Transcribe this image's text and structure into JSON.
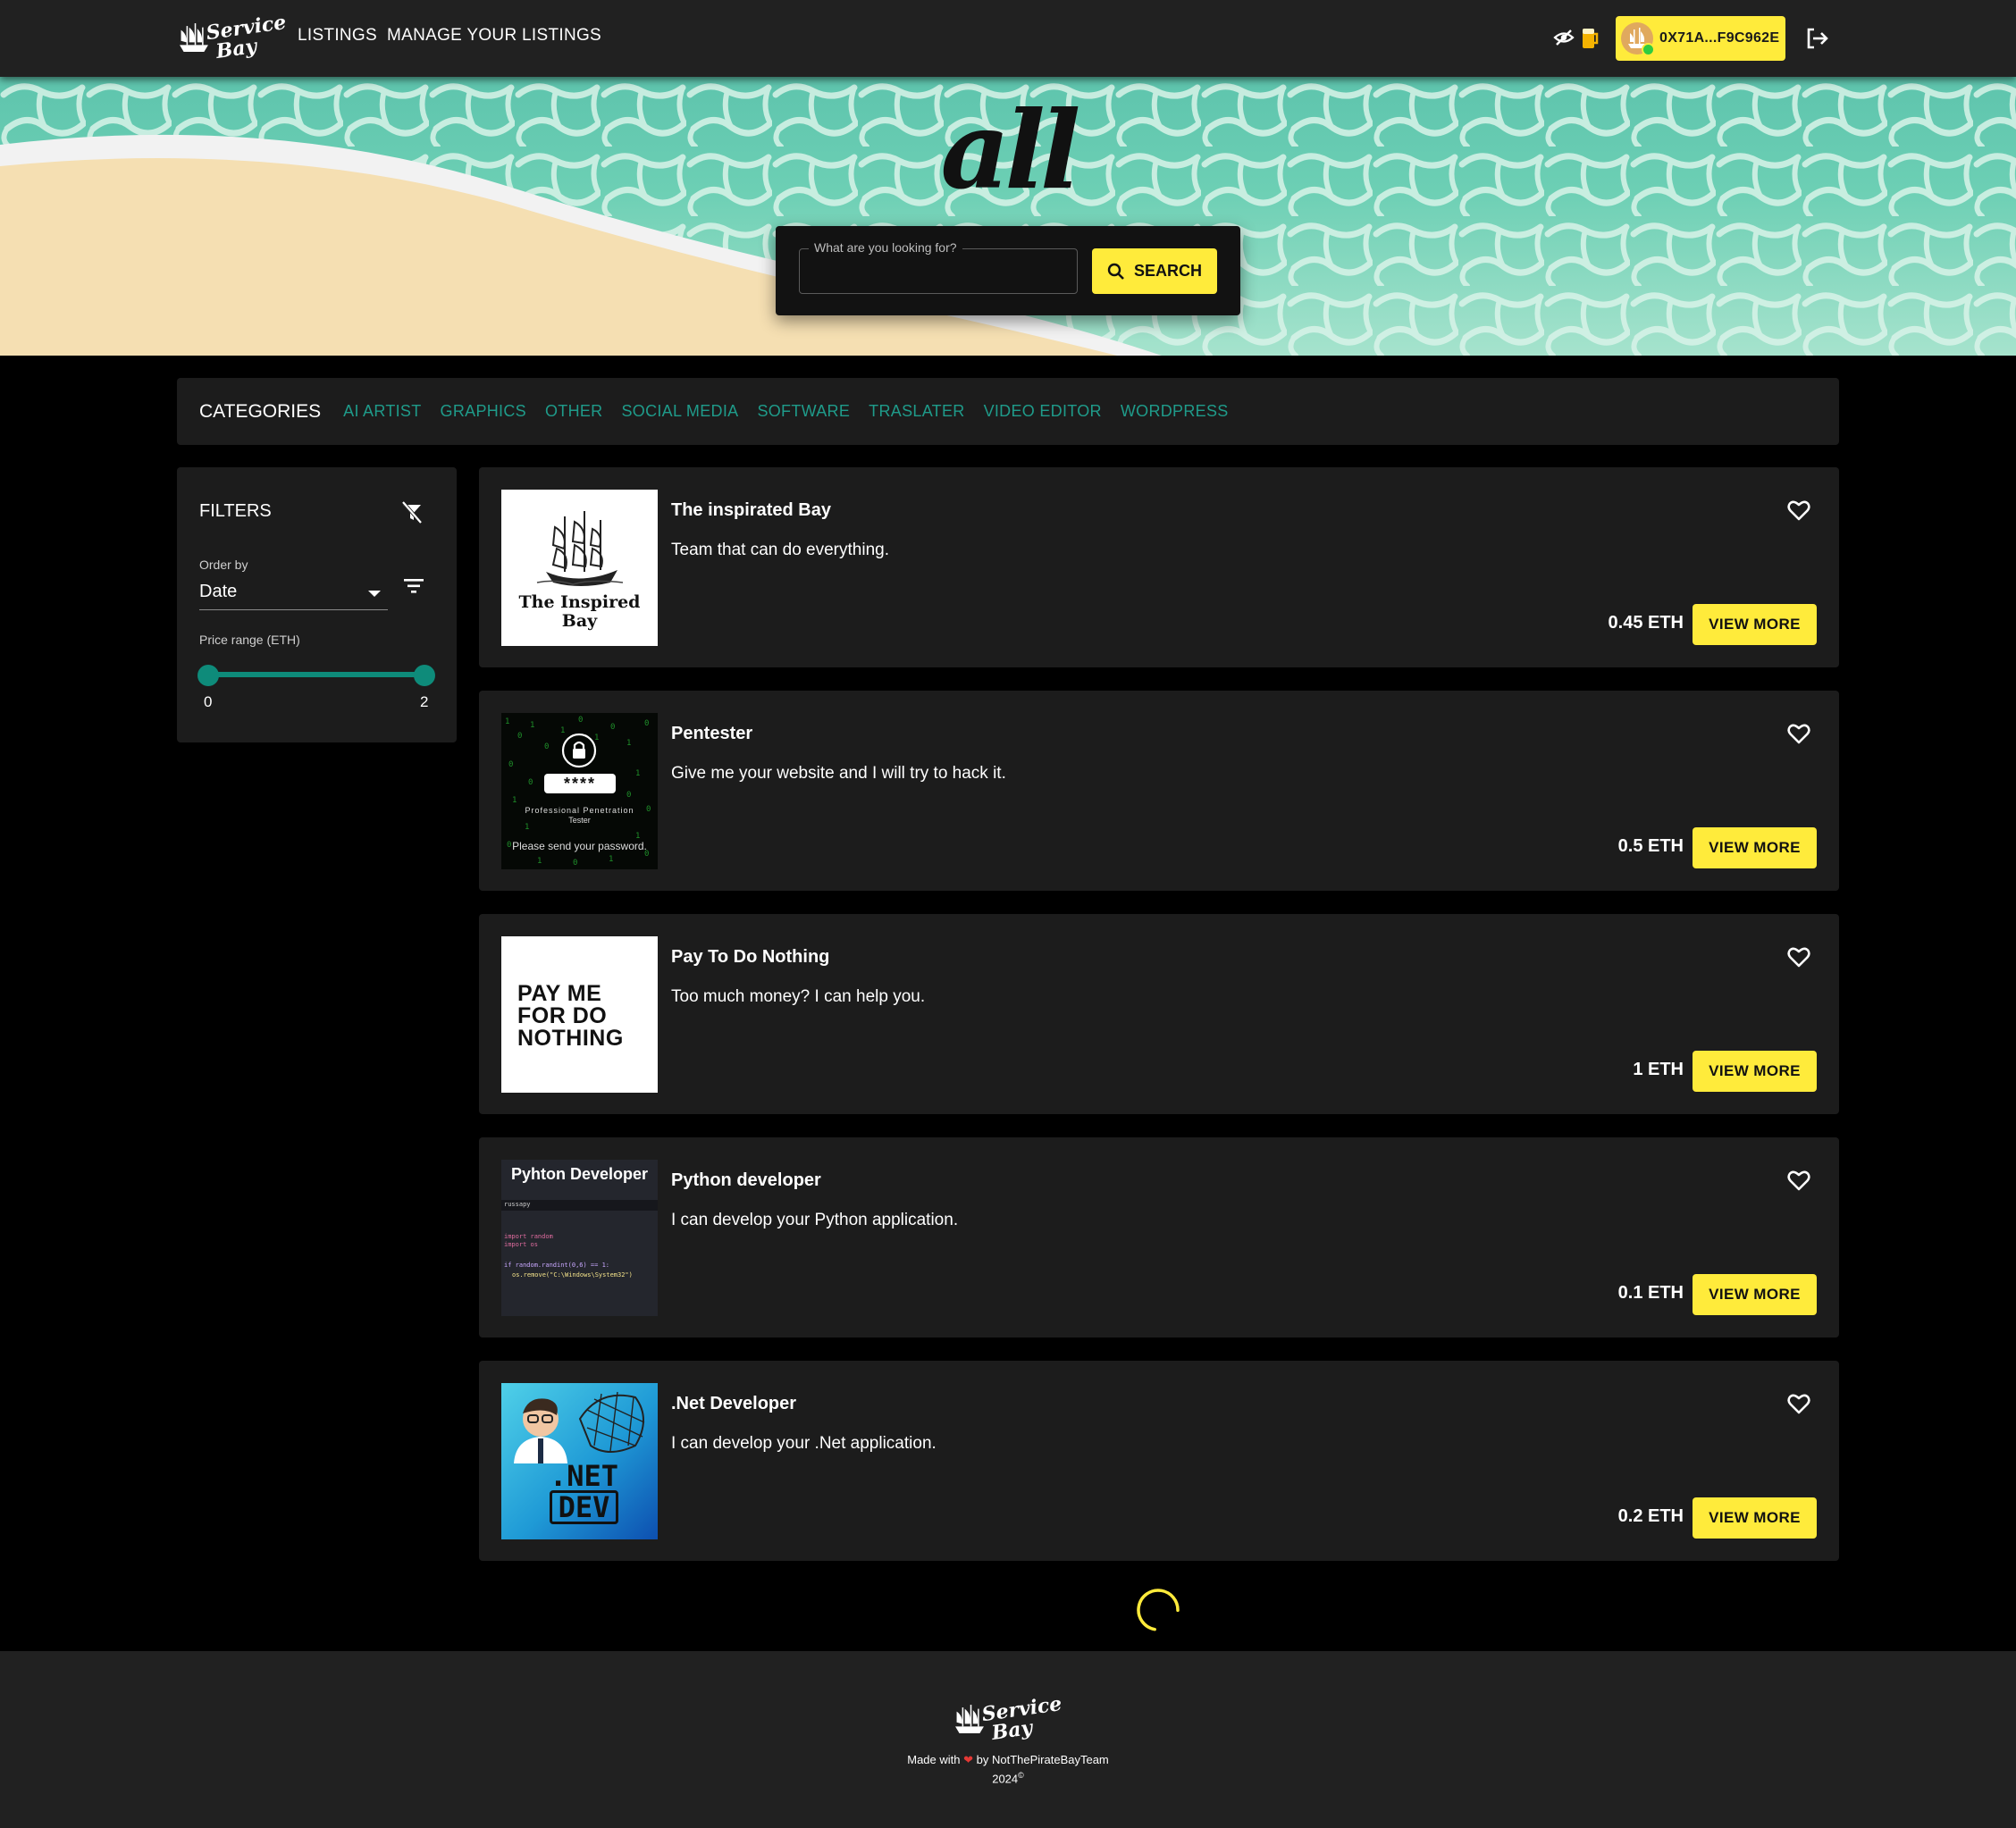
{
  "header": {
    "logo_line1": "Service",
    "logo_line2": "Bay",
    "nav": [
      "LISTINGS",
      "MANAGE YOUR LISTINGS"
    ],
    "wallet_address": "0X71A...F9C962E",
    "icons": [
      "eye-off-icon",
      "beer-icon",
      "logout-icon"
    ]
  },
  "hero": {
    "title": "all",
    "search_legend": "What are you looking for?",
    "search_value": "",
    "search_button": "SEARCH"
  },
  "categories": {
    "title": "CATEGORIES",
    "items": [
      "AI ARTIST",
      "GRAPHICS",
      "OTHER",
      "SOCIAL MEDIA",
      "SOFTWARE",
      "TRASLATER",
      "VIDEO EDITOR",
      "WORDPRESS"
    ]
  },
  "filters": {
    "title": "FILTERS",
    "order_label": "Order by",
    "order_value": "Date",
    "price_label": "Price range (ETH)",
    "price_min": "0",
    "price_max": "2"
  },
  "listings": [
    {
      "title": "The inspirated Bay",
      "description": "Team that can do everything.",
      "price": "0.45 ETH",
      "image_text": [
        "The Inspired",
        "Bay"
      ],
      "button": "VIEW MORE"
    },
    {
      "title": "Pentester",
      "description": "Give me your website and I will try to hack it.",
      "price": "0.5 ETH",
      "image_text": [
        "****",
        "Professional Penetration",
        "Tester",
        "Please send your password."
      ],
      "button": "VIEW MORE"
    },
    {
      "title": "Pay To Do Nothing",
      "description": "Too much money? I can help you.",
      "price": "1 ETH",
      "image_text": [
        "PAY ME",
        "FOR DO",
        "NOTHING"
      ],
      "button": "VIEW MORE"
    },
    {
      "title": "Python developer",
      "description": "I can develop your Python application.",
      "price": "0.1 ETH",
      "image_text": [
        "Pyhton Developer",
        "russapy",
        "import random",
        "import os",
        "if random.randint(0,6) == 1:",
        "os.remove(\"C:\\Windows\\System32\")"
      ],
      "button": "VIEW MORE"
    },
    {
      "title": ".Net Developer",
      "description": "I can develop your .Net application.",
      "price": "0.2 ETH",
      "image_text": [
        ".NET",
        "DEV"
      ],
      "button": "VIEW MORE"
    }
  ],
  "footer": {
    "logo_line1": "Service",
    "logo_line2": "Bay",
    "made_with": "Made with",
    "by_team": "by NotThePirateBayTeam",
    "year": "2024",
    "copyright": "©"
  },
  "colors": {
    "accent_yellow": "#ffeb3b",
    "teal": "#1f9b8a",
    "card_bg": "#1c1c1c",
    "bar_bg": "#212121"
  }
}
